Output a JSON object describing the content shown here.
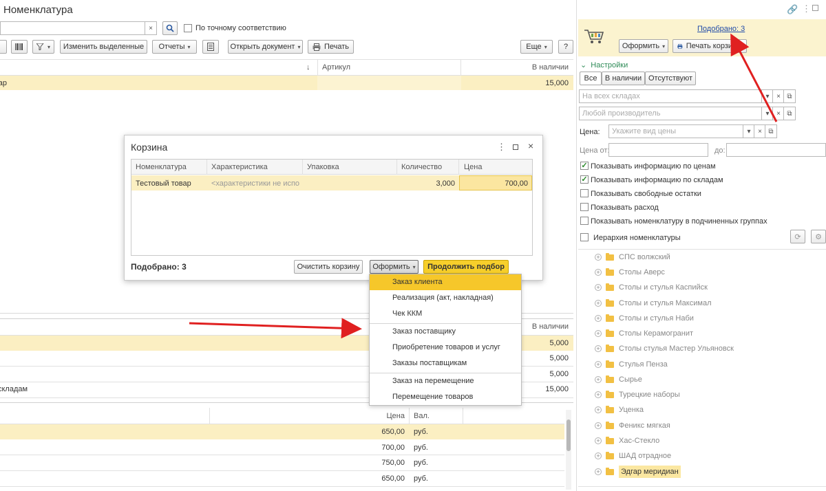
{
  "window": {
    "title": "Номенклатура"
  },
  "search": {
    "value": "",
    "clear": "×",
    "exact_match_label": "По точному соответствию"
  },
  "toolbar": {
    "edit_selected": "Изменить выделенные",
    "reports": "Отчеты",
    "open_document": "Открыть документ",
    "print": "Печать",
    "more": "Еще",
    "help": "?"
  },
  "main_table": {
    "sort_arrow": "↓",
    "col_article": "Артикул",
    "col_stock": "В наличии",
    "row1": {
      "name": "вар",
      "stock": "15,000"
    }
  },
  "stock_table": {
    "col_stock": "В наличии",
    "rows": [
      {
        "name": "",
        "stock": "5,000"
      },
      {
        "name": "",
        "stock": "5,000"
      },
      {
        "name": "",
        "stock": "5,000"
      },
      {
        "name": "складам",
        "stock": "15,000"
      }
    ]
  },
  "price_table": {
    "col_price": "Цена",
    "col_currency": "Вал.",
    "rows": [
      {
        "price": "650,00",
        "currency": "руб."
      },
      {
        "price": "700,00",
        "currency": "руб."
      },
      {
        "price": "750,00",
        "currency": "руб."
      },
      {
        "price": "650,00",
        "currency": "руб."
      }
    ]
  },
  "cart_panel": {
    "picked_link": "Подобрано: 3",
    "checkout": "Оформить",
    "print_cart": "Печать корзины",
    "settings_label": "Настройки",
    "filter_all": "Все",
    "filter_in_stock": "В наличии",
    "filter_absent": "Отсутствуют",
    "warehouses_placeholder": "На всех складах",
    "manufacturer_placeholder": "Любой производитель",
    "price_label": "Цена:",
    "price_placeholder": "Укажите вид цены",
    "price_from_label": "Цена от:",
    "price_to_label": "до:",
    "options": [
      {
        "label": "Показывать информацию по ценам",
        "checked": true
      },
      {
        "label": "Показывать информацию по складам",
        "checked": true
      },
      {
        "label": "Показывать свободные остатки",
        "checked": false
      },
      {
        "label": "Показывать расход",
        "checked": false
      },
      {
        "label": "Показывать номенклатуру в подчиненных группах",
        "checked": false
      }
    ],
    "hierarchy_label": "Иерархия номенклатуры",
    "tree": [
      "СПС волжский",
      "Столы Аверс",
      "Столы и стулья Каспийск",
      "Столы и стулья Максимал",
      "Столы и стулья Наби",
      "Столы Керамогранит",
      "Столы стулья Мастер Ульяновск",
      "Стулья Пенза",
      "Сырье",
      "Турецкие наборы",
      "Уценка",
      "Феникс мягкая",
      "Хас-Стекло",
      "ШАД отрадное",
      "Эдгар меридиан"
    ]
  },
  "cart_dialog": {
    "title": "Корзина",
    "columns": [
      "Номенклатура",
      "Характеристика",
      "Упаковка",
      "Количество",
      "Цена"
    ],
    "row": {
      "name": "Тестовый товар",
      "characteristic": "<характеристики не испо...",
      "package": "",
      "quantity": "3,000",
      "price": "700,00"
    },
    "footer_picked": "Подобрано: 3",
    "clear_cart": "Очистить корзину",
    "checkout": "Оформить",
    "continue": "Продолжить подбор"
  },
  "checkout_menu": {
    "groups": [
      [
        "Заказ клиента",
        "Реализация (акт, накладная)",
        "Чек ККМ"
      ],
      [
        "Заказ поставщику",
        "Приобретение товаров и услуг",
        "Заказы поставщикам"
      ],
      [
        "Заказ на перемещение",
        "Перемещение товаров"
      ]
    ]
  },
  "colors": {
    "highlight": "#fbefc2",
    "accent_yellow": "#f5c518",
    "arrow": "#e02020",
    "link": "#1f4aa8"
  }
}
